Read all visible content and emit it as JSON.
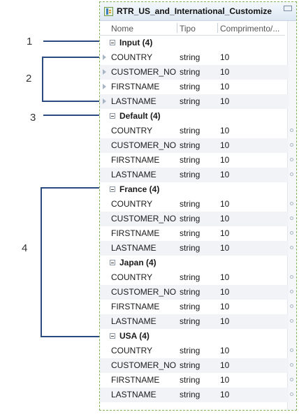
{
  "callouts": [
    "1",
    "2",
    "3",
    "4"
  ],
  "panel": {
    "title": "RTR_US_and_International_Customize",
    "columns": [
      "Nome",
      "Tipo",
      "Comprimento/..."
    ]
  },
  "groups": [
    {
      "label": "Input (4)",
      "ports": "input",
      "rows": [
        [
          "COUNTRY",
          "string",
          "10"
        ],
        [
          "CUSTOMER_NO",
          "string",
          "10"
        ],
        [
          "FIRSTNAME",
          "string",
          "10"
        ],
        [
          "LASTNAME",
          "string",
          "10"
        ]
      ]
    },
    {
      "label": "Default (4)",
      "ports": "output",
      "rows": [
        [
          "COUNTRY",
          "string",
          "10"
        ],
        [
          "CUSTOMER_NO",
          "string",
          "10"
        ],
        [
          "FIRSTNAME",
          "string",
          "10"
        ],
        [
          "LASTNAME",
          "string",
          "10"
        ]
      ]
    },
    {
      "label": "France (4)",
      "ports": "output",
      "rows": [
        [
          "COUNTRY",
          "string",
          "10"
        ],
        [
          "CUSTOMER_NO",
          "string",
          "10"
        ],
        [
          "FIRSTNAME",
          "string",
          "10"
        ],
        [
          "LASTNAME",
          "string",
          "10"
        ]
      ]
    },
    {
      "label": "Japan (4)",
      "ports": "output",
      "rows": [
        [
          "COUNTRY",
          "string",
          "10"
        ],
        [
          "CUSTOMER_NO",
          "string",
          "10"
        ],
        [
          "FIRSTNAME",
          "string",
          "10"
        ],
        [
          "LASTNAME",
          "string",
          "10"
        ]
      ]
    },
    {
      "label": "USA (4)",
      "ports": "output",
      "rows": [
        [
          "COUNTRY",
          "string",
          "10"
        ],
        [
          "CUSTOMER_NO",
          "string",
          "10"
        ],
        [
          "FIRSTNAME",
          "string",
          "10"
        ],
        [
          "LASTNAME",
          "string",
          "10"
        ]
      ]
    }
  ],
  "colors": {
    "accent_line": "#2a4a80",
    "panel_border": "#7fb35a"
  },
  "icons": {
    "title": "router-transformation-icon",
    "minimize": "minimize-icon"
  }
}
